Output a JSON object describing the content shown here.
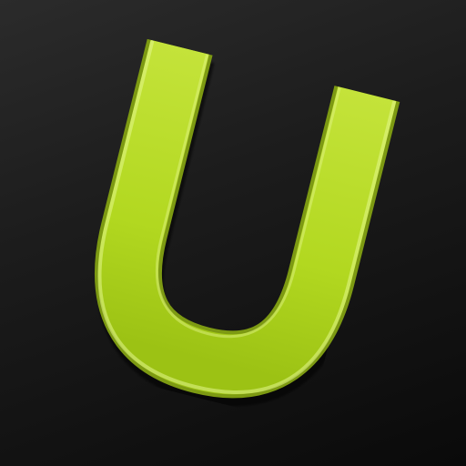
{
  "icon": {
    "name": "u-logo-app-icon",
    "glyph": "U",
    "colors": {
      "background_top": "#2b2b2b",
      "background_bottom": "#0a0a0a",
      "glyph_fill": "#b5dc22",
      "glyph_highlight": "#d9f27a",
      "glyph_shadow": "#6f8a10"
    }
  }
}
